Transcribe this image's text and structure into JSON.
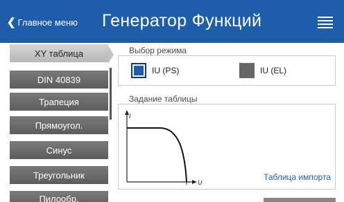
{
  "header": {
    "back_label": "Главное меню",
    "title": "Генератор Функций",
    "menu_icon": "hamburger-menu-icon"
  },
  "sidebar": {
    "items": [
      {
        "label": "XY таблица",
        "active": true
      },
      {
        "label": "DIN 40839",
        "active": false
      },
      {
        "label": "Трапеция",
        "active": false
      },
      {
        "label": "Прямоугол.",
        "active": false
      },
      {
        "label": "Синус",
        "active": false
      },
      {
        "label": "Треугольник",
        "active": false
      },
      {
        "label": "Пилообр.",
        "active": false
      }
    ]
  },
  "mode": {
    "label": "Выбор режима",
    "options": [
      {
        "label": "IU (PS)",
        "selected": true,
        "color": "#1e5daa"
      },
      {
        "label": "IU (EL)",
        "selected": false,
        "color": "#666666"
      }
    ]
  },
  "table": {
    "label": "Задание таблицы",
    "y_axis_label": "I",
    "x_axis_label": "U",
    "import_link": "Таблица импорта"
  },
  "colors": {
    "header_bg": "#1e5daa",
    "accent": "#1e5daa"
  }
}
